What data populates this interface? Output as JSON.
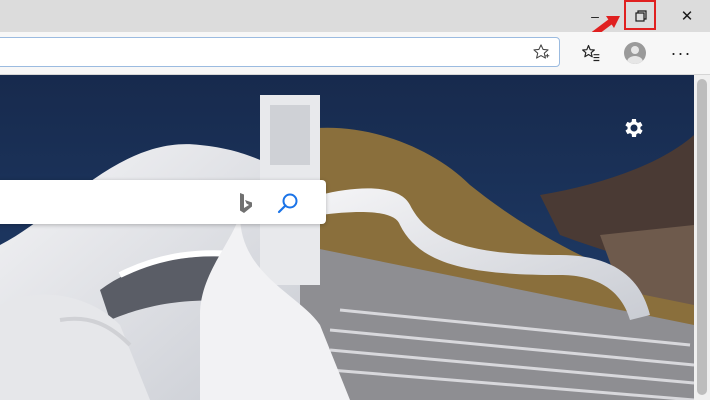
{
  "window": {
    "minimize_label": "–",
    "restore_icon": "restore-down-icon",
    "close_label": "✕"
  },
  "toolbar": {
    "address_value": "",
    "favorite_icon": "star-icon",
    "favorites_icon": "favorites-list-icon",
    "profile_icon": "profile-avatar-icon",
    "more_label": "···"
  },
  "newtab": {
    "settings_icon": "gear-icon",
    "search_placeholder": "",
    "bing_icon": "bing-logo-icon",
    "search_icon": "search-icon"
  },
  "colors": {
    "highlight": "#e02020",
    "accent": "#1a73e8"
  }
}
